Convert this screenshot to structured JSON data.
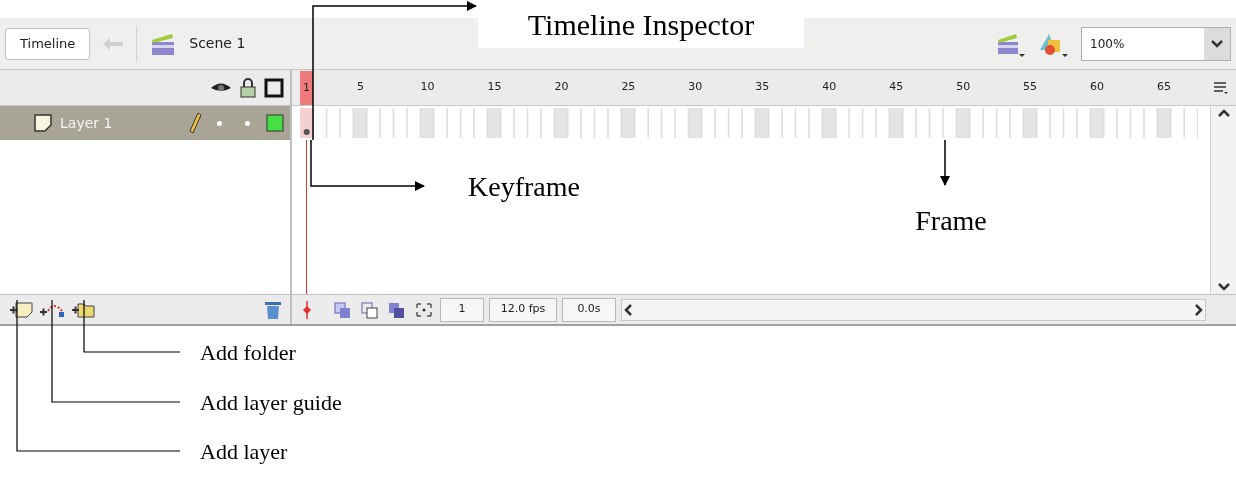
{
  "toolbar": {
    "timeline_button": "Timeline",
    "scene": "Scene 1",
    "zoom": "100%"
  },
  "ruler": {
    "labels": [
      "1",
      "5",
      "10",
      "15",
      "20",
      "25",
      "30",
      "35",
      "40",
      "45",
      "50",
      "55",
      "60",
      "65"
    ]
  },
  "layers": [
    {
      "name": "Layer 1",
      "selected": true
    }
  ],
  "status": {
    "frame": "1",
    "fps": "12.0 fps",
    "time": "0.0s"
  },
  "annotations": [
    {
      "text": "Timeline Inspector"
    },
    {
      "text": "Keyframe"
    },
    {
      "text": "Frame"
    },
    {
      "text": "Add folder"
    },
    {
      "text": "Add layer guide"
    },
    {
      "text": "Add layer"
    }
  ]
}
